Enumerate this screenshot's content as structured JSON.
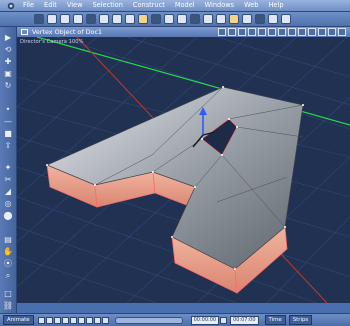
{
  "app": {
    "menu": [
      "File",
      "Edit",
      "View",
      "Selection",
      "Construct",
      "Model",
      "Windows",
      "Web",
      "Help"
    ]
  },
  "viewport": {
    "title": "Vertex Object of Doc1",
    "camera_label": "Director's Camera 100%"
  },
  "bottombar": {
    "mode": "Animate",
    "time_start": "00:00:00",
    "time_end": "00:07:00",
    "time_label": "Time",
    "time_unit": "Strips"
  },
  "colors": {
    "grid": "#304a78",
    "face_edge": "#ff6a6a",
    "accent": "#f3d58a"
  }
}
